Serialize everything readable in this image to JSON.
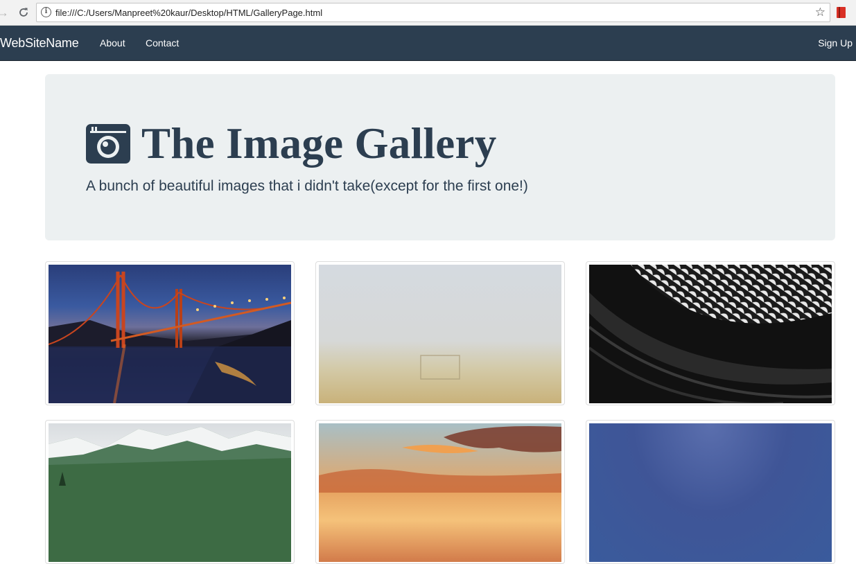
{
  "browser": {
    "url": "file:///C:/Users/Manpreet%20kaur/Desktop/HTML/GalleryPage.html",
    "icons": [
      "back-arrow-icon",
      "reload-icon",
      "info-icon",
      "star-icon",
      "extension-icon"
    ]
  },
  "navbar": {
    "brand": "WebSiteName",
    "links": [
      "About",
      "Contact"
    ],
    "right_link": "Sign Up",
    "background": "#2c3e50"
  },
  "jumbotron": {
    "icon": "camera-icon",
    "title": "The Image Gallery",
    "subtitle": "A bunch of beautiful images that i didn't take(except for the first one!)",
    "background": "#ecf0f1",
    "text_color": "#2c3e50"
  },
  "gallery": {
    "images": [
      {
        "subject": "golden-gate-bridge-night"
      },
      {
        "subject": "foggy-field"
      },
      {
        "subject": "abstract-architecture-bw"
      },
      {
        "subject": "snowy-mountains"
      },
      {
        "subject": "sunset-clouds"
      },
      {
        "subject": "blue-sky"
      }
    ]
  }
}
